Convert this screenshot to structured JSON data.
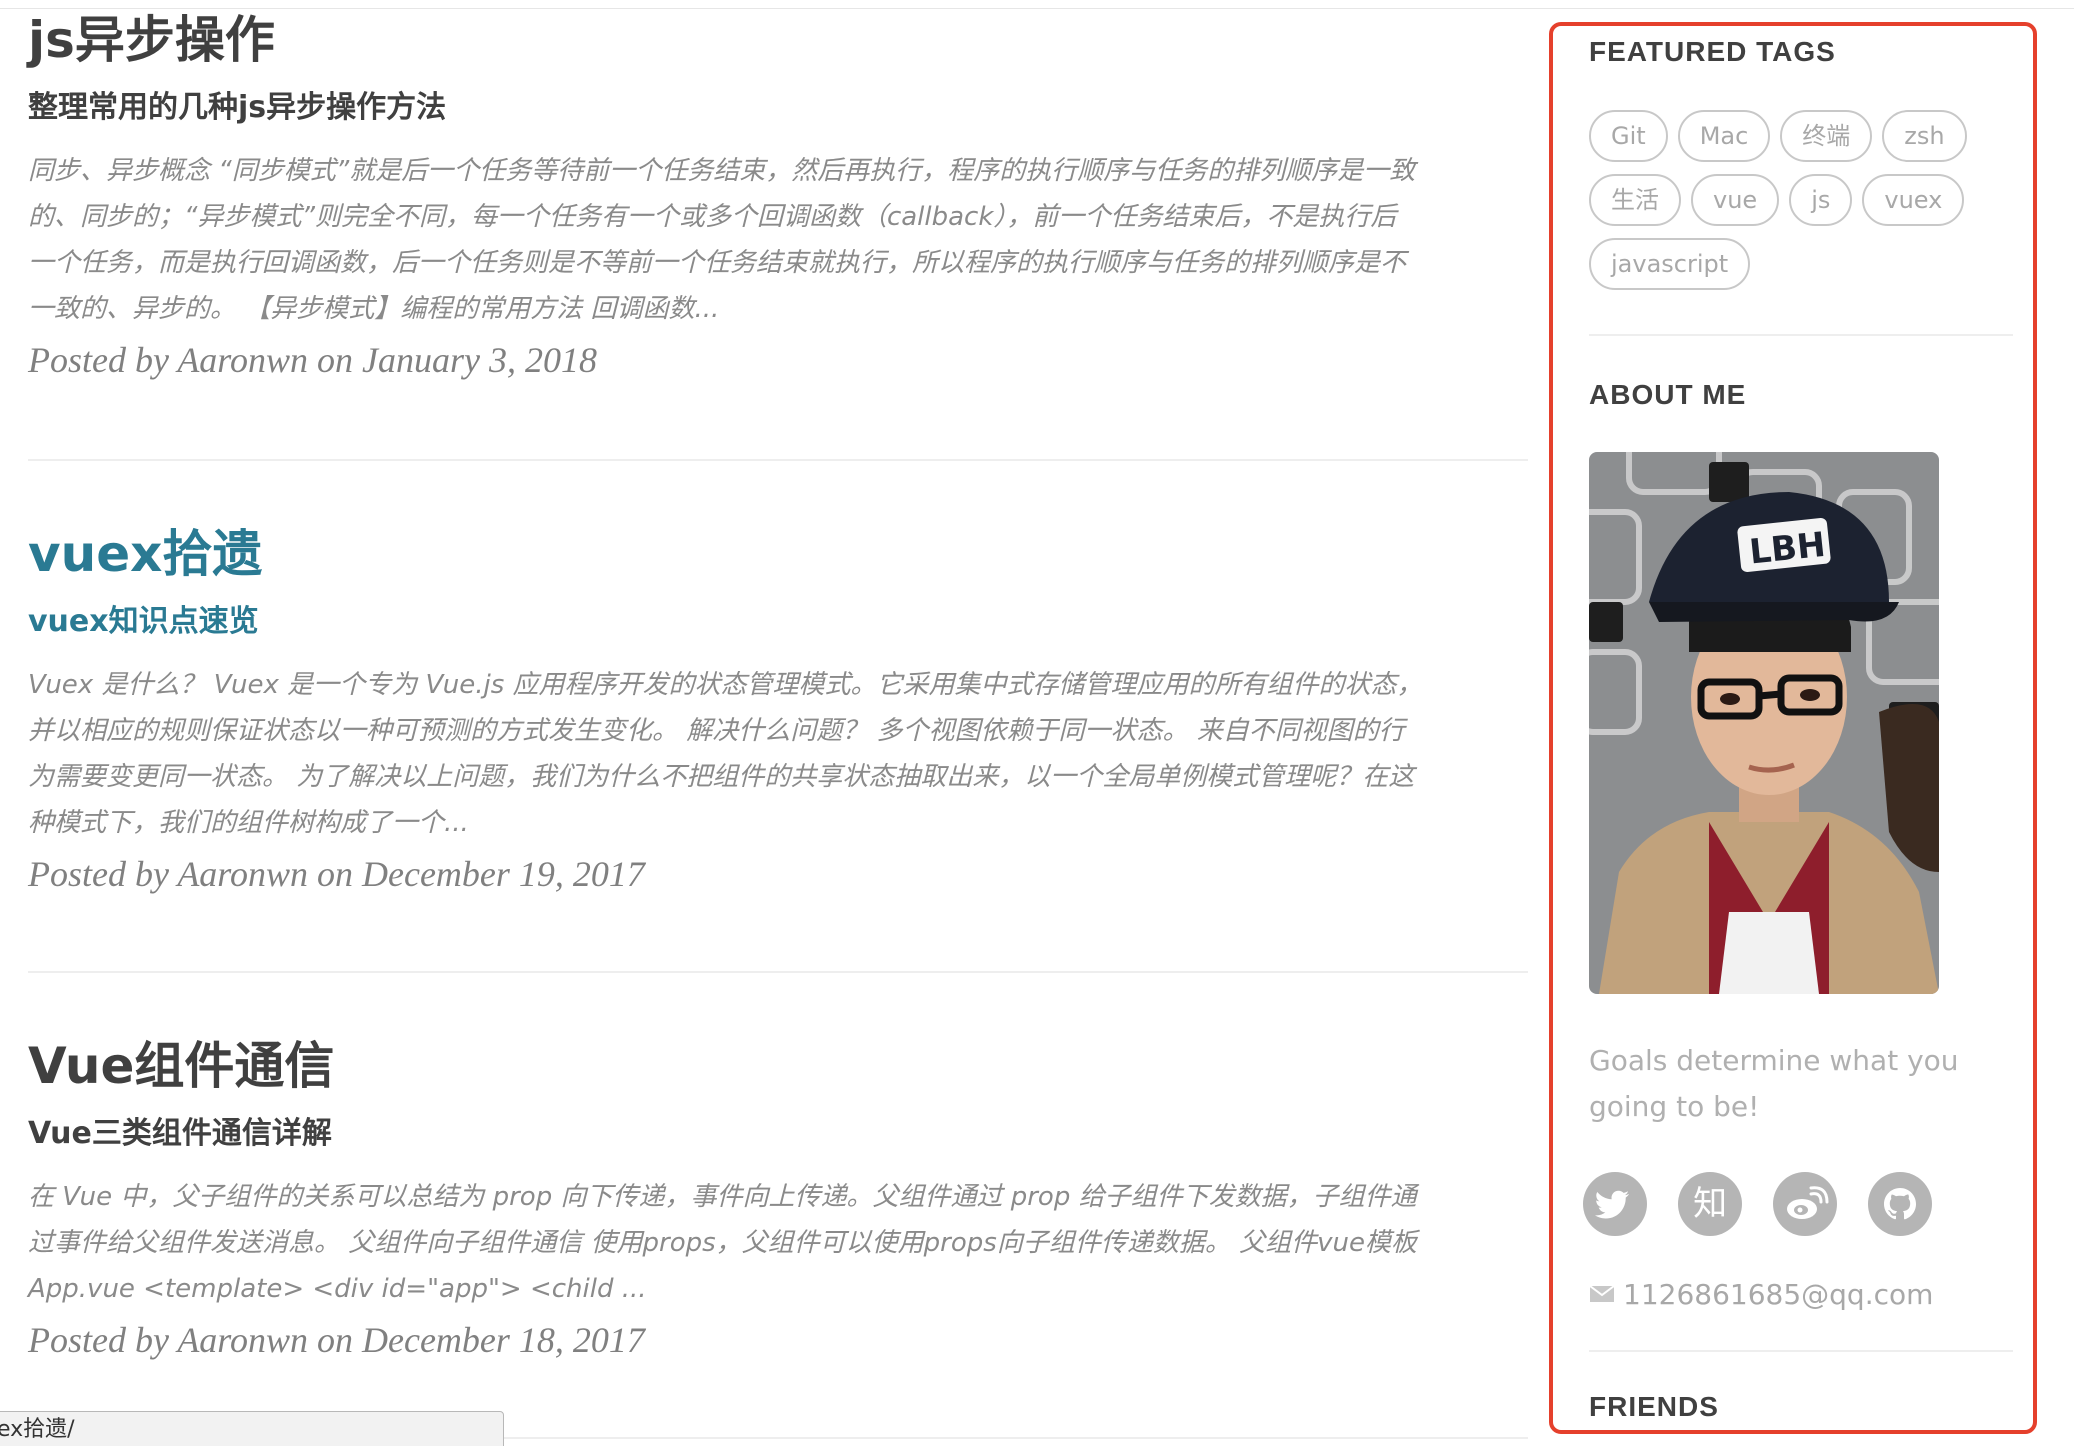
{
  "posts": [
    {
      "title": "js异步操作",
      "subtitle": "整理常用的几种js异步操作方法",
      "excerpt": "同步、异步概念 “同步模式”就是后一个任务等待前一个任务结束，然后再执行，程序的执行顺序与任务的排列顺序是一致\n的、同步的；“异步模式”则完全不同，每一个任务有一个或多个回调函数（callback），前一个任务结束后，不是执行后\n一个任务，而是执行回调函数，后一个任务则是不等前一个任务结束就执行，所以程序的执行顺序与任务的排列顺序是不\n一致的、异步的。 【异步模式】编程的常用方法 回调函数...",
      "meta_prefix": "Posted by ",
      "author": "Aaronwn",
      "meta_on": " on ",
      "date": "January 3, 2018"
    },
    {
      "title": "vuex拾遗",
      "subtitle": "vuex知识点速览",
      "excerpt": "Vuex 是什么？ Vuex 是一个专为 Vue.js 应用程序开发的状态管理模式。它采用集中式存储管理应用的所有组件的状态，\n并以相应的规则保证状态以一种可预测的方式发生变化。 解决什么问题？ 多个视图依赖于同一状态。 来自不同视图的行\n为需要变更同一状态。 为了解决以上问题，我们为什么不把组件的共享状态抽取出来，以一个全局单例模式管理呢？在这\n种模式下，我们的组件树构成了一个...",
      "meta_prefix": "Posted by ",
      "author": "Aaronwn",
      "meta_on": " on ",
      "date": "December 19, 2017"
    },
    {
      "title": "Vue组件通信",
      "subtitle": "Vue三类组件通信详解",
      "excerpt": "在 Vue 中，父子组件的关系可以总结为 prop 向下传递，事件向上传递。父组件通过 prop 给子组件下发数据，子组件通\n过事件给父组件发送消息。 父组件向子组件通信 使用props，父组件可以使用props向子组件传递数据。 父组件vue模板\nApp.vue <template> <div id=\"app\"> <child ...",
      "meta_prefix": "Posted by ",
      "author": "Aaronwn",
      "meta_on": " on ",
      "date": "December 18, 2017"
    }
  ],
  "status_bar": {
    "text": "ex拾遗/"
  },
  "sidebar": {
    "featured_tags_heading": "FEATURED TAGS",
    "tags": [
      "Git",
      "Mac",
      "终端",
      "zsh",
      "生活",
      "vue",
      "js",
      "vuex",
      "javascript"
    ],
    "about_heading": "ABOUT ME",
    "motto": "Goals determine what you going to be!",
    "social": [
      {
        "name": "twitter-icon",
        "glyph": ""
      },
      {
        "name": "zhihu-icon",
        "glyph": "知"
      },
      {
        "name": "weibo-icon",
        "glyph": ""
      },
      {
        "name": "github-icon",
        "glyph": ""
      }
    ],
    "email": "1126861685@qq.com",
    "friends_heading": "FRIENDS"
  },
  "colors": {
    "link_active": "#2a7a93",
    "highlight_border": "#e5402c",
    "text_dark": "#404040",
    "text_muted": "#8a8a8a"
  }
}
